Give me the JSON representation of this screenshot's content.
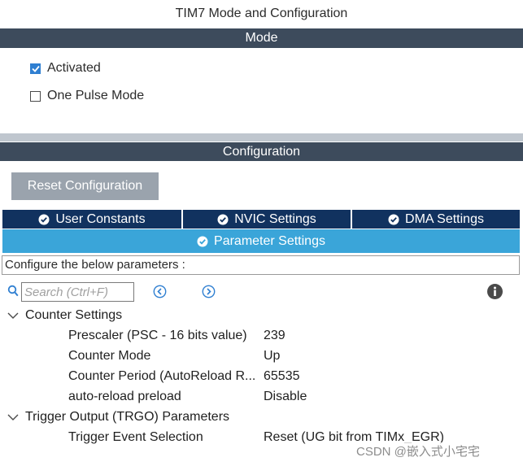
{
  "window": {
    "title": "TIM7 Mode and Configuration"
  },
  "mode": {
    "header": "Mode",
    "options": [
      {
        "label": "Activated",
        "checked": true
      },
      {
        "label": "One Pulse Mode",
        "checked": false
      }
    ]
  },
  "configuration": {
    "header": "Configuration",
    "reset_label": "Reset Configuration",
    "tabs": [
      {
        "label": "User Constants"
      },
      {
        "label": "NVIC Settings"
      },
      {
        "label": "DMA Settings"
      }
    ],
    "active_tab": {
      "label": "Parameter Settings"
    },
    "instructions": "Configure the below parameters :",
    "search": {
      "placeholder": "Search (Ctrl+F)",
      "value": ""
    },
    "groups": [
      {
        "title": "Counter Settings",
        "params": [
          {
            "name": "Prescaler (PSC - 16 bits value)",
            "value": "239"
          },
          {
            "name": "Counter Mode",
            "value": "Up"
          },
          {
            "name": "Counter Period (AutoReload R...",
            "value": "65535"
          },
          {
            "name": "auto-reload preload",
            "value": "Disable"
          }
        ]
      },
      {
        "title": "Trigger Output (TRGO) Parameters",
        "params": [
          {
            "name": "Trigger Event Selection",
            "value": "Reset (UG bit from TIMx_EGR)"
          }
        ]
      }
    ]
  },
  "watermark": "CSDN @嵌入式小宅宅",
  "colors": {
    "section_bar": "#3d4b5c",
    "tab_dark": "#11325f",
    "tab_active": "#3aa5d9",
    "checkbox_checked": "#2f7fd1",
    "reset_button": "#9aa3ad"
  }
}
